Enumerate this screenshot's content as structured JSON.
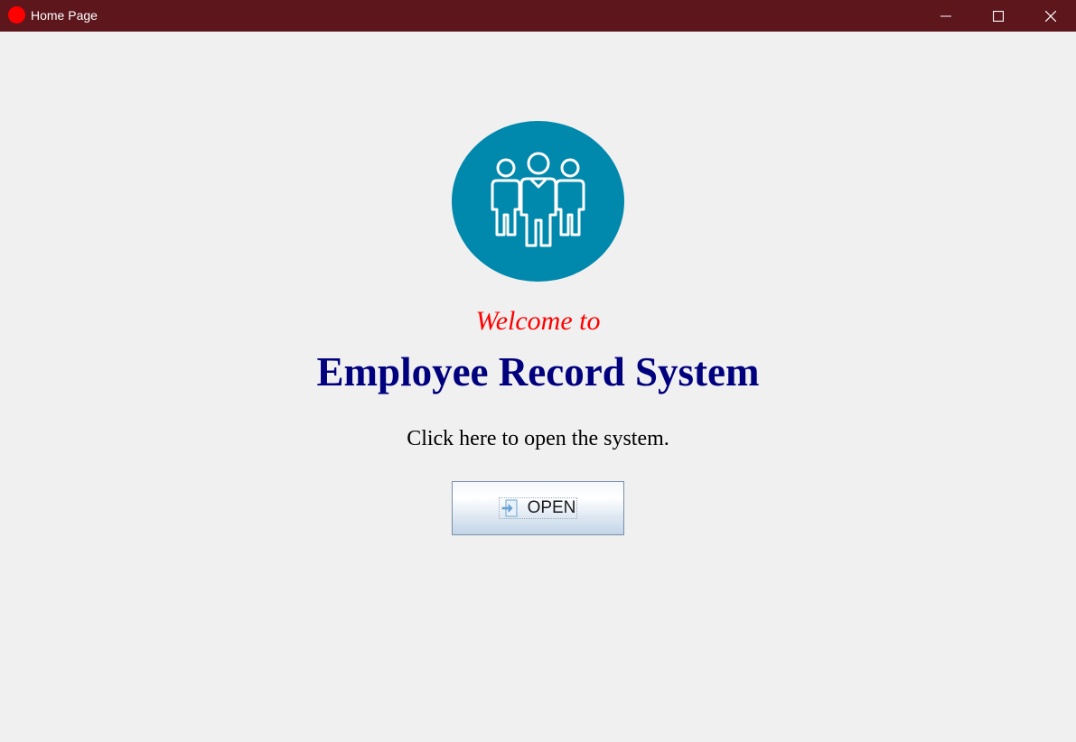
{
  "window": {
    "title": "Home Page",
    "controls": [
      "minimize-icon",
      "maximize-icon",
      "close-icon"
    ],
    "titlebar_color": "#5c161c",
    "app_icon_color": "#ff0000"
  },
  "main": {
    "logo_icon": "employees-group-icon",
    "logo_color": "#0088ad",
    "welcome_text": "Welcome to",
    "welcome_color": "#ff0000",
    "system_title": "Employee Record System",
    "system_title_color": "#00007f",
    "instruction_text": "Click here to open the system.",
    "open_button": {
      "label": "OPEN",
      "icon": "login-arrow-icon"
    }
  }
}
